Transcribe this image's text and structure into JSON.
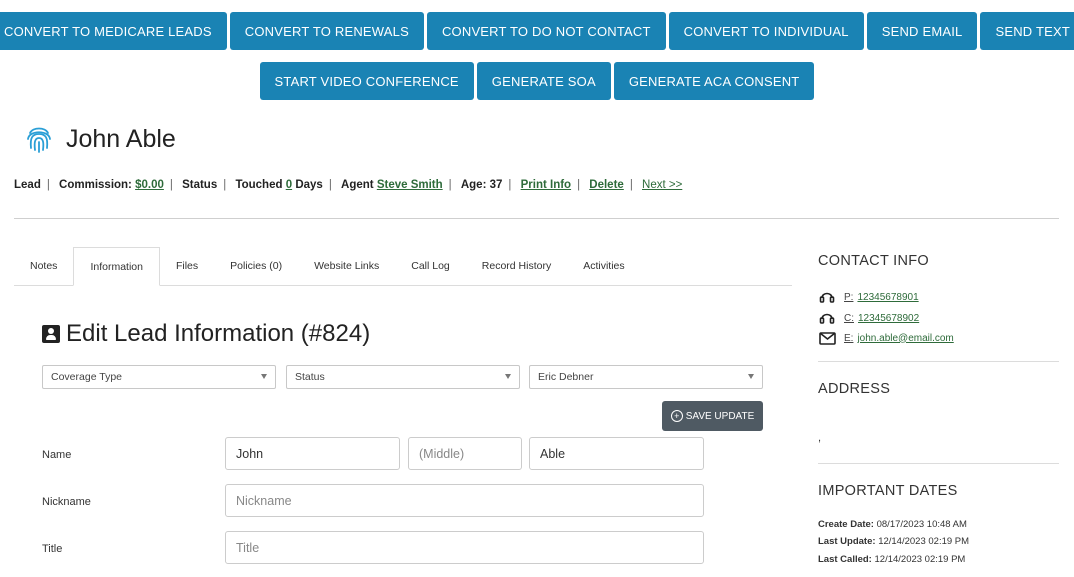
{
  "actions": {
    "row1": [
      "CONVERT TO MEDICARE LEADS",
      "CONVERT TO RENEWALS",
      "CONVERT TO DO NOT CONTACT",
      "CONVERT TO INDIVIDUAL",
      "SEND EMAIL",
      "SEND TEXT"
    ],
    "row2": [
      "START VIDEO CONFERENCE",
      "GENERATE SOA",
      "GENERATE ACA CONSENT"
    ]
  },
  "lead": {
    "name": "John Able",
    "type": "Lead",
    "commission_label": "Commission:",
    "commission_value": "$0.00",
    "status_label": "Status",
    "touched_label": "Touched",
    "touched_value": "0",
    "touched_unit": "Days",
    "agent_label": "Agent",
    "agent_value": "Steve Smith",
    "age_label": "Age:",
    "age_value": "37",
    "print_info": "Print Info",
    "delete": "Delete",
    "next": "Next >>"
  },
  "tabs": [
    "Notes",
    "Information",
    "Files",
    "Policies (0)",
    "Website Links",
    "Call Log",
    "Record History",
    "Activities"
  ],
  "active_tab": "Information",
  "edit": {
    "title": "Edit Lead Information (#824)",
    "coverage_type": "Coverage Type",
    "status": "Status",
    "agent": "Eric Debner",
    "save_label": "SAVE UPDATE",
    "fields": {
      "name_label": "Name",
      "first": "John",
      "middle_placeholder": "(Middle)",
      "last": "Able",
      "nickname_label": "Nickname",
      "nickname_placeholder": "Nickname",
      "title_label": "Title",
      "title_placeholder": "Title"
    }
  },
  "contact": {
    "heading": "CONTACT INFO",
    "phone_label": "P:",
    "phone": "12345678901",
    "cell_label": "C:",
    "cell": "12345678902",
    "email_label": "E:",
    "email": "john.able@email.com"
  },
  "address": {
    "heading": "ADDRESS",
    "value": ","
  },
  "dates": {
    "heading": "IMPORTANT DATES",
    "create_label": "Create Date:",
    "create": "08/17/2023 10:48 AM",
    "update_label": "Last Update:",
    "update": "12/14/2023 02:19 PM",
    "called_label": "Last Called:",
    "called": "12/14/2023 02:19 PM"
  },
  "colors": {
    "action_blue": "#1a83b4",
    "link_green": "#2e6b3a",
    "save_gray": "#4f5a63",
    "fingerprint_blue": "#2a9fd6"
  },
  "icons": {
    "lead": "fingerprint-icon",
    "edit": "contact-card-icon",
    "phone": "headset-icon",
    "email": "envelope-icon",
    "save": "plus-circle-icon"
  }
}
